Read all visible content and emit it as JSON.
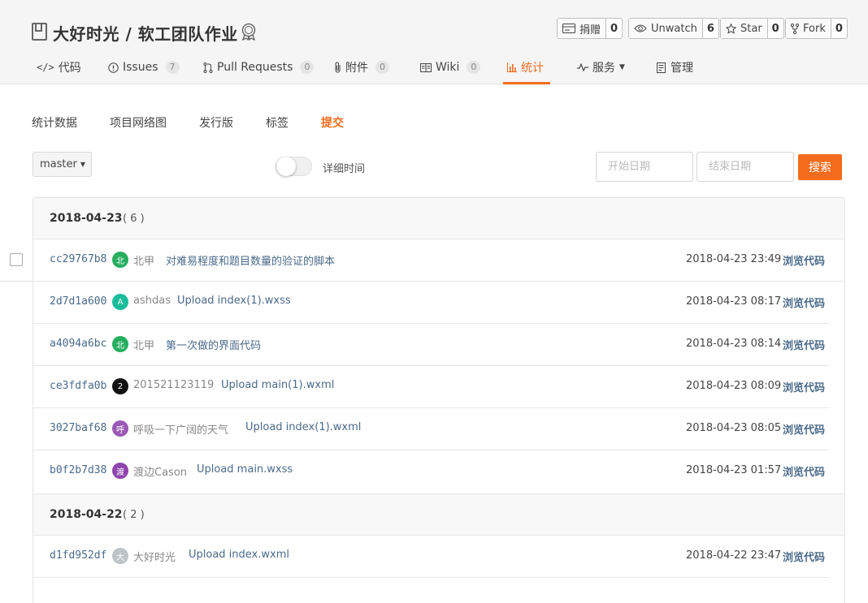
{
  "repo": {
    "title": "大好时光 / 软工团队作业"
  },
  "actions": [
    {
      "icon": "donate-icon",
      "label": "捐赠",
      "count": "0"
    },
    {
      "icon": "eye-icon",
      "label": "Unwatch",
      "count": "6"
    },
    {
      "icon": "star-icon",
      "label": "Star",
      "count": "0"
    },
    {
      "icon": "fork-icon",
      "label": "Fork",
      "count": "0"
    }
  ],
  "tabs": [
    {
      "icon": "code-icon",
      "label": "代码"
    },
    {
      "icon": "info-icon",
      "label": "Issues",
      "badge": "7"
    },
    {
      "icon": "pull-request-icon",
      "label": "Pull Requests",
      "badge": "0"
    },
    {
      "icon": "attachment-icon",
      "label": "附件",
      "badge": "0"
    },
    {
      "icon": "wiki-icon",
      "label": "Wiki",
      "badge": "0"
    },
    {
      "icon": "chart-icon",
      "label": "统计"
    },
    {
      "icon": "pulse-icon",
      "label": "服务"
    },
    {
      "icon": "manage-icon",
      "label": "管理"
    }
  ],
  "subnav": [
    "统计数据",
    "项目网络图",
    "发行版",
    "标签",
    "提交"
  ],
  "filter": {
    "branch": "master",
    "toggle_label": "详细时间",
    "start_placeholder": "开始日期",
    "end_placeholder": "结束日期",
    "search_label": "搜索"
  },
  "groups": [
    {
      "date": "2018-04-23",
      "count": "( 6 )",
      "commits": [
        {
          "sha": "cc29767b8",
          "avatar": "北",
          "avatar_color": "#27ae60",
          "author": "北甲",
          "message": "对难易程度和题目数量的验证的脚本",
          "time": "2018-04-23 23:49",
          "browse": "浏览代码"
        },
        {
          "sha": "2d7d1a600",
          "avatar": "A",
          "avatar_color": "#1abc9c",
          "author": "ashdas",
          "message": "Upload index(1).wxss",
          "time": "2018-04-23 08:17",
          "browse": "浏览代码"
        },
        {
          "sha": "a4094a6bc",
          "avatar": "北",
          "avatar_color": "#27ae60",
          "author": "北甲",
          "message": "第一次做的界面代码",
          "time": "2018-04-23 08:14",
          "browse": "浏览代码"
        },
        {
          "sha": "ce3fdfa0b",
          "avatar": "2",
          "avatar_color": "#111111",
          "author": "201521123119",
          "message": "Upload main(1).wxml",
          "time": "2018-04-23 08:09",
          "browse": "浏览代码"
        },
        {
          "sha": "3027baf68",
          "avatar": "呼",
          "avatar_color": "#9b59b6",
          "author": "呼吸一下广阔的天气",
          "message": "Upload index(1).wxml",
          "time": "2018-04-23 08:05",
          "browse": "浏览代码"
        },
        {
          "sha": "b0f2b7d38",
          "avatar": "渡",
          "avatar_color": "#8e44ad",
          "author": "渡边Cason",
          "message": "Upload main.wxss",
          "time": "2018-04-23 01:57",
          "browse": "浏览代码"
        }
      ]
    },
    {
      "date": "2018-04-22",
      "count": "( 2 )",
      "commits": [
        {
          "sha": "d1fd952df",
          "avatar": "大",
          "avatar_color": "#bdc3c7",
          "author": "大好时光",
          "message": "Upload index.wxml",
          "time": "2018-04-22 23:47",
          "browse": "浏览代码"
        }
      ]
    }
  ]
}
